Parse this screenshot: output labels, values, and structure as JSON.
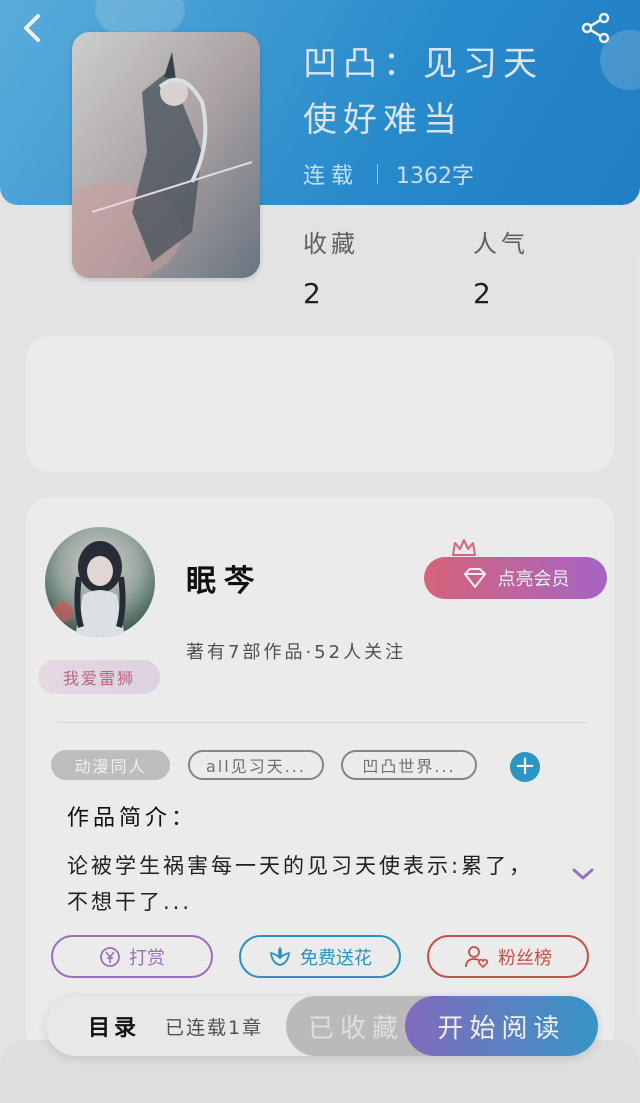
{
  "header": {
    "back_icon": "chevron-left-icon",
    "share_icon": "share-icon"
  },
  "book": {
    "title_line1": "凹凸：见习天",
    "title_line2": "使好难当",
    "status": "连载",
    "word_count": "1362字",
    "collect_label": "收藏",
    "collect_value": "2",
    "popularity_label": "人气",
    "popularity_value": "2"
  },
  "author": {
    "name": "眠芩",
    "badge": "我爱雷狮",
    "meta": "著有7部作品·52人关注",
    "vip_button": "点亮会员"
  },
  "tags": [
    "动漫同人",
    "all见习天...",
    "凹凸世界..."
  ],
  "intro": {
    "title": "作品简介：",
    "text": "论被学生祸害每一天的见习天使表示:累了，不想干了..."
  },
  "actions": {
    "reward": "打赏",
    "flower": "免费送花",
    "fans": "粉丝榜"
  },
  "bottom": {
    "toc": "目录",
    "serial": "已连载1章",
    "collected": "已收藏",
    "read": "开始阅读"
  },
  "colors": {
    "header_blue": "#2c94d8",
    "vip_pink": "#e46a82",
    "reward_purple": "#a277c5",
    "flower_blue": "#2e9ad0",
    "fans_red": "#d2544c"
  }
}
